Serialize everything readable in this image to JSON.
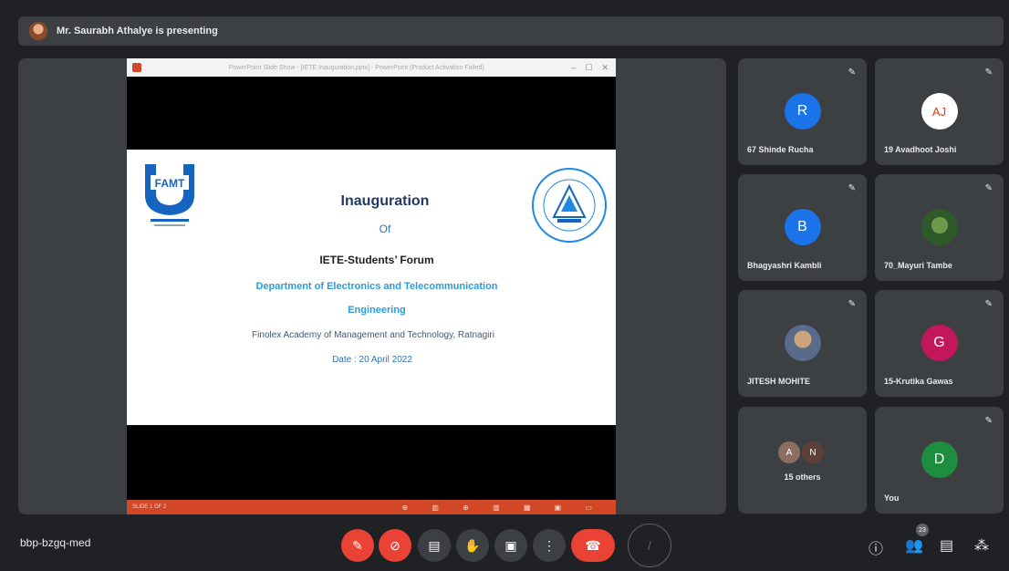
{
  "header": {
    "presenting_text": "Mr. Saurabh Athalye is presenting"
  },
  "presentation": {
    "window_title": "PowerPoint Slide Show - [IETE Inauguration.pptx] - PowerPoint (Product Activation Failed)",
    "window_controls": {
      "minimize": "–",
      "maximize": "☐",
      "close": "✕"
    },
    "slide": {
      "famt_logo_text": "FAMT",
      "title": "Inauguration",
      "of": "Of",
      "forum": "IETE-Students’ Forum",
      "department_line1": "Department of Electronics and Telecommunication",
      "department_line2": "Engineering",
      "academy": "Finolex Academy of Management and Technology, Ratnagiri",
      "date": "Date : 20 April 2022"
    },
    "status_left": "SLIDE 1 OF 2",
    "status_icons": "⊕ ▥ ⊕ ▥ ▦ ▣ ▭"
  },
  "participants": [
    {
      "name": "67 Shinde Rucha",
      "initial": "R",
      "color": "#1a73e8"
    },
    {
      "name": "19 Avadhoot Joshi",
      "initial": "AJ",
      "color": "#ffffff"
    },
    {
      "name": "Bhagyashri Kambli",
      "initial": "B",
      "color": "#1a73e8"
    },
    {
      "name": "70_Mayuri Tambe",
      "initial": "",
      "color": "#6a9a4a"
    },
    {
      "name": "JITESH MOHITE",
      "initial": "",
      "color": "#c9a37a"
    },
    {
      "name": "15-Krutika Gawas",
      "initial": "G",
      "color": "#c2185b"
    },
    {
      "name": "15 others",
      "initials": [
        "A",
        "N"
      ]
    },
    {
      "name": "You",
      "initial": "D",
      "color": "#1e8e3e"
    }
  ],
  "bottom": {
    "meeting_code": "bbp-bzgq-med",
    "participant_count": "23"
  }
}
